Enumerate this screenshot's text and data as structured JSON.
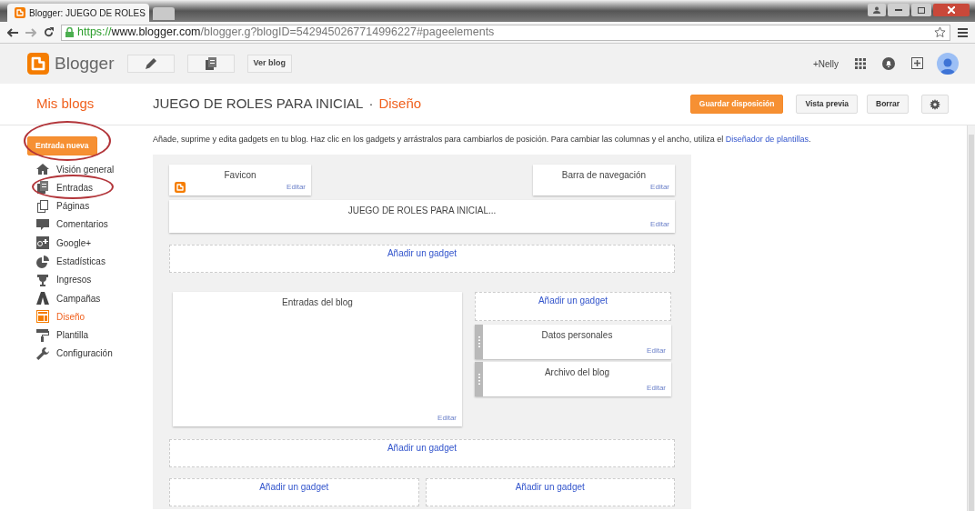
{
  "browser": {
    "tab_title": "Blogger: JUEGO DE ROLES",
    "address": {
      "scheme": "https://",
      "host": "www.blogger.com",
      "path": "/blogger.g?blogID=5429450267714996227#pageelements"
    }
  },
  "header": {
    "logo_text": "Blogger",
    "view_blog": "Ver blog",
    "user": "+Nelly"
  },
  "blog_bar": {
    "my_blogs": "Mis blogs",
    "blog_title": "JUEGO DE ROLES PARA INICIAL",
    "separator": "·",
    "section": "Diseño",
    "buttons": [
      "Guardar disposición",
      "Vista previa",
      "Borrar"
    ]
  },
  "sidebar": {
    "new_post": {
      "label": "Entrada nueva",
      "highlighted": true
    },
    "items": [
      {
        "label": "Visión general",
        "kind": "home",
        "selected": false,
        "highlighted": false
      },
      {
        "label": "Entradas",
        "kind": "posts",
        "selected": false,
        "highlighted": true
      },
      {
        "label": "Páginas",
        "kind": "pages",
        "selected": false,
        "highlighted": false
      },
      {
        "label": "Comentarios",
        "kind": "comments",
        "selected": false,
        "highlighted": false
      },
      {
        "label": "Google+",
        "kind": "gplus",
        "selected": false,
        "highlighted": false
      },
      {
        "label": "Estadísticas",
        "kind": "stats",
        "selected": false,
        "highlighted": false
      },
      {
        "label": "Ingresos",
        "kind": "earnings",
        "selected": false,
        "highlighted": false
      },
      {
        "label": "Campañas",
        "kind": "campaigns",
        "selected": false,
        "highlighted": false
      },
      {
        "label": "Diseño",
        "kind": "layout",
        "selected": true,
        "highlighted": false
      },
      {
        "label": "Plantilla",
        "kind": "template",
        "selected": false,
        "highlighted": false
      },
      {
        "label": "Configuración",
        "kind": "settings",
        "selected": false,
        "highlighted": false
      }
    ]
  },
  "intro": {
    "text": "Añade, suprime y edita gadgets en tu blog. Haz clic en los gadgets y arrástralos para cambiarlos de posición. Para cambiar las columnas y el ancho, utiliza el",
    "link": "Diseñador de plantillas",
    "end": "."
  },
  "layout": {
    "top_row": [
      {
        "title": "Favicon",
        "edit": "Editar",
        "kind": "favicon"
      },
      {
        "title": "Barra de navegación",
        "edit": "Editar",
        "kind": "plain"
      }
    ],
    "header": {
      "title": "JUEGO DE ROLES PARA INICIAL...",
      "edit": "Editar"
    },
    "add_top": "Añadir un gadget",
    "main": {
      "title": "Entradas del blog",
      "edit": "Editar"
    },
    "sidebar_add": "Añadir un gadget",
    "sidebar_gadgets": [
      {
        "title": "Datos personales",
        "edit": "Editar"
      },
      {
        "title": "Archivo del blog",
        "edit": "Editar"
      }
    ],
    "add_bottom": "Añadir un gadget",
    "footer_adds": [
      "Añadir un gadget",
      "Añadir un gadget"
    ]
  }
}
